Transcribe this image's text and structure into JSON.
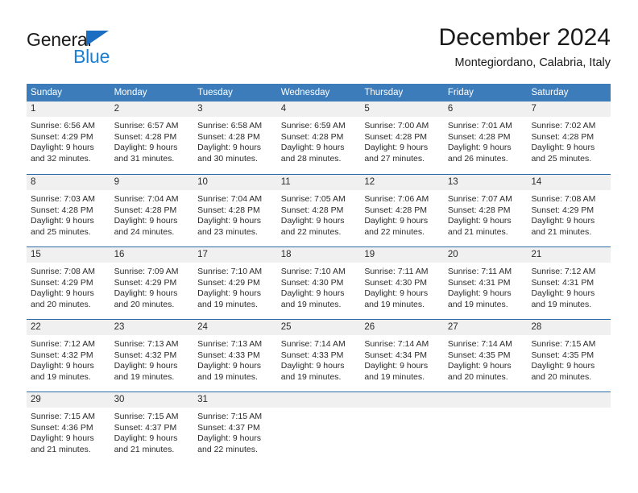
{
  "brand": {
    "name_part1": "General",
    "name_part2": "Blue",
    "triangle_color": "#1b6dc1",
    "blue_text_color": "#1b7fd4"
  },
  "header": {
    "title": "December 2024",
    "subtitle": "Montegiordano, Calabria, Italy"
  },
  "theme": {
    "header_blue": "#3c7cba",
    "row_divider_blue": "#2b6ca8",
    "daynum_band": "#f0f0f0",
    "text": "#2b2b2b"
  },
  "weekdays": [
    "Sunday",
    "Monday",
    "Tuesday",
    "Wednesday",
    "Thursday",
    "Friday",
    "Saturday"
  ],
  "weeks": [
    [
      {
        "day": "1",
        "l1": "Sunrise: 6:56 AM",
        "l2": "Sunset: 4:29 PM",
        "l3": "Daylight: 9 hours",
        "l4": "and 32 minutes."
      },
      {
        "day": "2",
        "l1": "Sunrise: 6:57 AM",
        "l2": "Sunset: 4:28 PM",
        "l3": "Daylight: 9 hours",
        "l4": "and 31 minutes."
      },
      {
        "day": "3",
        "l1": "Sunrise: 6:58 AM",
        "l2": "Sunset: 4:28 PM",
        "l3": "Daylight: 9 hours",
        "l4": "and 30 minutes."
      },
      {
        "day": "4",
        "l1": "Sunrise: 6:59 AM",
        "l2": "Sunset: 4:28 PM",
        "l3": "Daylight: 9 hours",
        "l4": "and 28 minutes."
      },
      {
        "day": "5",
        "l1": "Sunrise: 7:00 AM",
        "l2": "Sunset: 4:28 PM",
        "l3": "Daylight: 9 hours",
        "l4": "and 27 minutes."
      },
      {
        "day": "6",
        "l1": "Sunrise: 7:01 AM",
        "l2": "Sunset: 4:28 PM",
        "l3": "Daylight: 9 hours",
        "l4": "and 26 minutes."
      },
      {
        "day": "7",
        "l1": "Sunrise: 7:02 AM",
        "l2": "Sunset: 4:28 PM",
        "l3": "Daylight: 9 hours",
        "l4": "and 25 minutes."
      }
    ],
    [
      {
        "day": "8",
        "l1": "Sunrise: 7:03 AM",
        "l2": "Sunset: 4:28 PM",
        "l3": "Daylight: 9 hours",
        "l4": "and 25 minutes."
      },
      {
        "day": "9",
        "l1": "Sunrise: 7:04 AM",
        "l2": "Sunset: 4:28 PM",
        "l3": "Daylight: 9 hours",
        "l4": "and 24 minutes."
      },
      {
        "day": "10",
        "l1": "Sunrise: 7:04 AM",
        "l2": "Sunset: 4:28 PM",
        "l3": "Daylight: 9 hours",
        "l4": "and 23 minutes."
      },
      {
        "day": "11",
        "l1": "Sunrise: 7:05 AM",
        "l2": "Sunset: 4:28 PM",
        "l3": "Daylight: 9 hours",
        "l4": "and 22 minutes."
      },
      {
        "day": "12",
        "l1": "Sunrise: 7:06 AM",
        "l2": "Sunset: 4:28 PM",
        "l3": "Daylight: 9 hours",
        "l4": "and 22 minutes."
      },
      {
        "day": "13",
        "l1": "Sunrise: 7:07 AM",
        "l2": "Sunset: 4:28 PM",
        "l3": "Daylight: 9 hours",
        "l4": "and 21 minutes."
      },
      {
        "day": "14",
        "l1": "Sunrise: 7:08 AM",
        "l2": "Sunset: 4:29 PM",
        "l3": "Daylight: 9 hours",
        "l4": "and 21 minutes."
      }
    ],
    [
      {
        "day": "15",
        "l1": "Sunrise: 7:08 AM",
        "l2": "Sunset: 4:29 PM",
        "l3": "Daylight: 9 hours",
        "l4": "and 20 minutes."
      },
      {
        "day": "16",
        "l1": "Sunrise: 7:09 AM",
        "l2": "Sunset: 4:29 PM",
        "l3": "Daylight: 9 hours",
        "l4": "and 20 minutes."
      },
      {
        "day": "17",
        "l1": "Sunrise: 7:10 AM",
        "l2": "Sunset: 4:29 PM",
        "l3": "Daylight: 9 hours",
        "l4": "and 19 minutes."
      },
      {
        "day": "18",
        "l1": "Sunrise: 7:10 AM",
        "l2": "Sunset: 4:30 PM",
        "l3": "Daylight: 9 hours",
        "l4": "and 19 minutes."
      },
      {
        "day": "19",
        "l1": "Sunrise: 7:11 AM",
        "l2": "Sunset: 4:30 PM",
        "l3": "Daylight: 9 hours",
        "l4": "and 19 minutes."
      },
      {
        "day": "20",
        "l1": "Sunrise: 7:11 AM",
        "l2": "Sunset: 4:31 PM",
        "l3": "Daylight: 9 hours",
        "l4": "and 19 minutes."
      },
      {
        "day": "21",
        "l1": "Sunrise: 7:12 AM",
        "l2": "Sunset: 4:31 PM",
        "l3": "Daylight: 9 hours",
        "l4": "and 19 minutes."
      }
    ],
    [
      {
        "day": "22",
        "l1": "Sunrise: 7:12 AM",
        "l2": "Sunset: 4:32 PM",
        "l3": "Daylight: 9 hours",
        "l4": "and 19 minutes."
      },
      {
        "day": "23",
        "l1": "Sunrise: 7:13 AM",
        "l2": "Sunset: 4:32 PM",
        "l3": "Daylight: 9 hours",
        "l4": "and 19 minutes."
      },
      {
        "day": "24",
        "l1": "Sunrise: 7:13 AM",
        "l2": "Sunset: 4:33 PM",
        "l3": "Daylight: 9 hours",
        "l4": "and 19 minutes."
      },
      {
        "day": "25",
        "l1": "Sunrise: 7:14 AM",
        "l2": "Sunset: 4:33 PM",
        "l3": "Daylight: 9 hours",
        "l4": "and 19 minutes."
      },
      {
        "day": "26",
        "l1": "Sunrise: 7:14 AM",
        "l2": "Sunset: 4:34 PM",
        "l3": "Daylight: 9 hours",
        "l4": "and 19 minutes."
      },
      {
        "day": "27",
        "l1": "Sunrise: 7:14 AM",
        "l2": "Sunset: 4:35 PM",
        "l3": "Daylight: 9 hours",
        "l4": "and 20 minutes."
      },
      {
        "day": "28",
        "l1": "Sunrise: 7:15 AM",
        "l2": "Sunset: 4:35 PM",
        "l3": "Daylight: 9 hours",
        "l4": "and 20 minutes."
      }
    ],
    [
      {
        "day": "29",
        "l1": "Sunrise: 7:15 AM",
        "l2": "Sunset: 4:36 PM",
        "l3": "Daylight: 9 hours",
        "l4": "and 21 minutes."
      },
      {
        "day": "30",
        "l1": "Sunrise: 7:15 AM",
        "l2": "Sunset: 4:37 PM",
        "l3": "Daylight: 9 hours",
        "l4": "and 21 minutes."
      },
      {
        "day": "31",
        "l1": "Sunrise: 7:15 AM",
        "l2": "Sunset: 4:37 PM",
        "l3": "Daylight: 9 hours",
        "l4": "and 22 minutes."
      },
      {
        "day": "",
        "l1": "",
        "l2": "",
        "l3": "",
        "l4": ""
      },
      {
        "day": "",
        "l1": "",
        "l2": "",
        "l3": "",
        "l4": ""
      },
      {
        "day": "",
        "l1": "",
        "l2": "",
        "l3": "",
        "l4": ""
      },
      {
        "day": "",
        "l1": "",
        "l2": "",
        "l3": "",
        "l4": ""
      }
    ]
  ]
}
